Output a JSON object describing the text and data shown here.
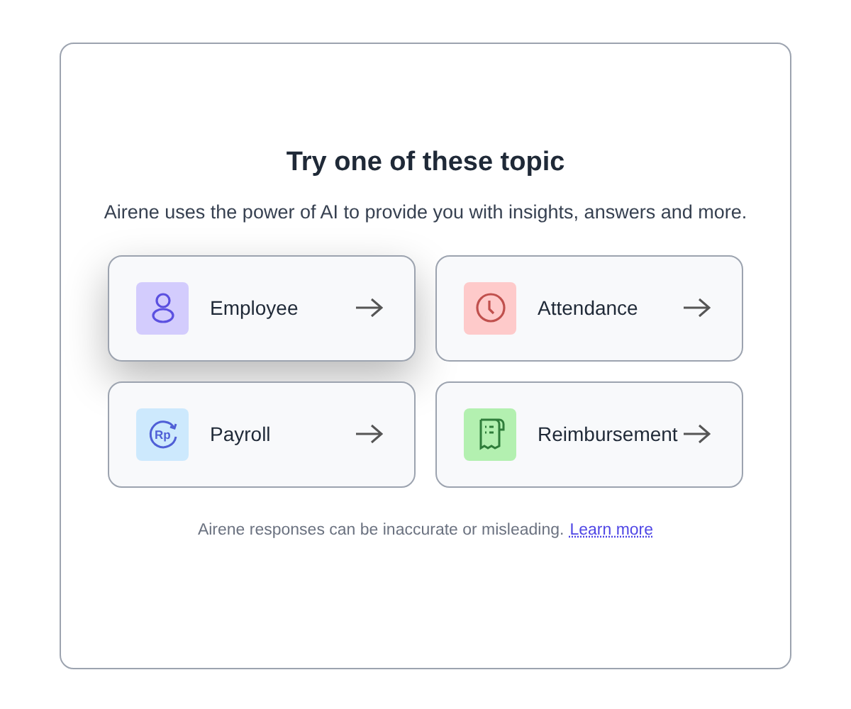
{
  "heading": "Try one of these topic",
  "subtitle": "Airene uses the power of AI to provide you with insights, answers and more.",
  "topics": [
    {
      "label": "Employee",
      "kind": "person",
      "color": "#d3ccfd",
      "hovered": true
    },
    {
      "label": "Attendance",
      "kind": "clock",
      "color": "#fecaca",
      "hovered": false
    },
    {
      "label": "Payroll",
      "kind": "currency",
      "icon_text": "Rp",
      "color": "#cde9fd",
      "hovered": false
    },
    {
      "label": "Reimbursement",
      "kind": "receipt",
      "color": "#b3f0b0",
      "hovered": false
    }
  ],
  "disclaimer": "Airene responses can be inaccurate or misleading.",
  "link": "Learn more"
}
